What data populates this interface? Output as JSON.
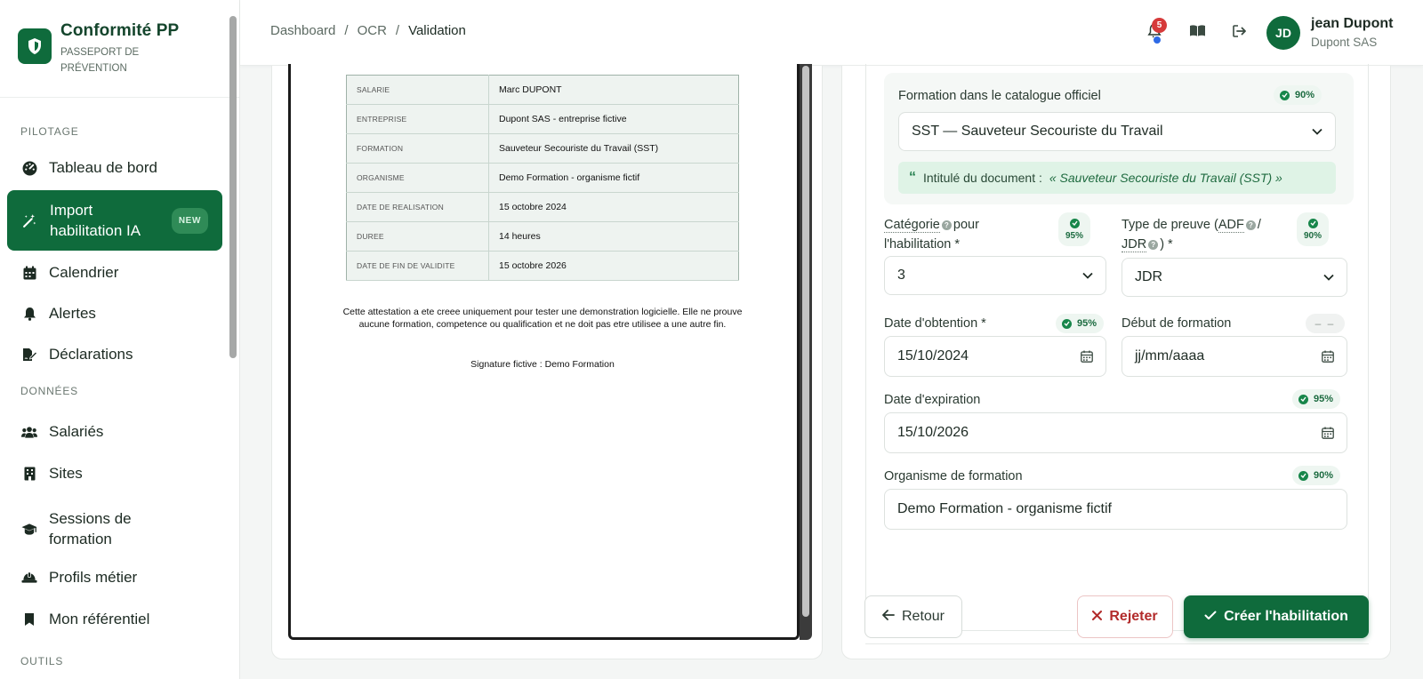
{
  "brand": {
    "title": "Conformité PP",
    "subtitle": "PASSEPORT DE PRÉVENTION"
  },
  "sidebar": {
    "sections": [
      {
        "label": "PILOTAGE"
      },
      {
        "label": "DONNÉES"
      },
      {
        "label": "OUTILS"
      }
    ],
    "items": [
      {
        "label": "Tableau de bord",
        "icon": "gauge-icon"
      },
      {
        "label": "Import habilitation IA",
        "icon": "magic-wand-icon",
        "badge": "NEW",
        "active": true
      },
      {
        "label": "Calendrier",
        "icon": "calendar-icon"
      },
      {
        "label": "Alertes",
        "icon": "bell-icon"
      },
      {
        "label": "Déclarations",
        "icon": "file-signature-icon"
      },
      {
        "label": "Salariés",
        "icon": "users-icon"
      },
      {
        "label": "Sites",
        "icon": "building-icon"
      },
      {
        "label": "Sessions de formation",
        "icon": "graduation-cap-icon"
      },
      {
        "label": "Profils métier",
        "icon": "hard-hat-icon"
      },
      {
        "label": "Mon référentiel",
        "icon": "bookmark-icon"
      }
    ]
  },
  "header": {
    "breadcrumb": [
      "Dashboard",
      "/",
      "OCR",
      "/",
      "Validation"
    ],
    "notifications": "5",
    "user": {
      "initials": "JD",
      "name": "jean Dupont",
      "company": "Dupont SAS"
    }
  },
  "document": {
    "rows": [
      {
        "key": "SALARIE",
        "value": "Marc DUPONT"
      },
      {
        "key": "ENTREPRISE",
        "value": "Dupont SAS - entreprise fictive"
      },
      {
        "key": "FORMATION",
        "value": "Sauveteur Secouriste du Travail (SST)"
      },
      {
        "key": "ORGANISME",
        "value": "Demo Formation - organisme fictif"
      },
      {
        "key": "DATE DE REALISATION",
        "value": "15 octobre 2024"
      },
      {
        "key": "DUREE",
        "value": "14 heures"
      },
      {
        "key": "DATE DE FIN DE VALIDITE",
        "value": "15 octobre 2026"
      }
    ],
    "note": "Cette attestation a ete creee uniquement pour tester une demonstration logicielle. Elle ne prouve aucune formation, competence ou qualification et ne doit pas etre utilisee a une autre fin.",
    "signature": "Signature fictive : Demo Formation"
  },
  "form": {
    "catalog": {
      "label": "Formation dans le catalogue officiel",
      "confidence": "90%",
      "value": "SST — Sauveteur Secouriste du Travail",
      "doc_title_label": "Intitulé du document :",
      "doc_title_value": "« Sauveteur Secouriste du Travail (SST) »"
    },
    "category": {
      "label_a": "Catégorie",
      "label_b": "pour",
      "label_c": "l'habilitation *",
      "confidence": "95%",
      "value": "3"
    },
    "proof_type": {
      "label_a": "Type de preuve (",
      "adf": "ADF",
      "label_b": "/",
      "jdr": "JDR",
      "label_c": ") *",
      "confidence": "90%",
      "value": "JDR"
    },
    "date_obtention": {
      "label": "Date d'obtention *",
      "confidence": "95%",
      "value": "15/10/2024"
    },
    "date_debut": {
      "label": "Début de formation",
      "confidence": "– –",
      "placeholder": "jj/mm/aaaa"
    },
    "date_expiration": {
      "label": "Date d'expiration",
      "confidence": "95%",
      "value": "15/10/2026"
    },
    "organisme": {
      "label": "Organisme de formation",
      "confidence": "90%",
      "value": "Demo Formation - organisme fictif"
    }
  },
  "actions": {
    "back": "Retour",
    "reject": "Rejeter",
    "create": "Créer l'habilitation"
  },
  "colors": {
    "primary": "#0f6b3c",
    "danger": "#b22b2b",
    "accent_light": "#dff3e6"
  }
}
